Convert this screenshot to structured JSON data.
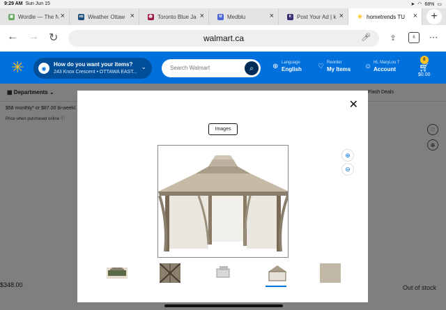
{
  "status": {
    "time": "9:29 AM",
    "date": "Sun Jun 15",
    "battery": "68%"
  },
  "tabs": [
    {
      "label": "Wordle — The N",
      "color": "#6aaa64",
      "glyph": "▦"
    },
    {
      "label": "Weather Ottaw",
      "color": "#1f4e79",
      "glyph": "nb"
    },
    {
      "label": "Toronto Blue Ja",
      "color": "#a0194a",
      "glyph": "⚾"
    },
    {
      "label": "Medblu",
      "color": "#4a66d6",
      "glyph": "M"
    },
    {
      "label": "Post Your Ad | k",
      "color": "#373373",
      "glyph": "K"
    },
    {
      "label": "hometrends TU",
      "color": "#ffc220",
      "glyph": "✳"
    }
  ],
  "url": "walmart.ca",
  "tab_count": "6",
  "header": {
    "store_title": "How do you want your items?",
    "store_address": "243 Knox Crescent • OTTAWA EAST...",
    "search_placeholder": "Search Walmart",
    "language_small": "Language",
    "language_big": "English",
    "reorder_small": "Reorder",
    "reorder_big": "My Items",
    "account_small": "Hi, MaryLou T",
    "account_big": "Account",
    "cart_count": "0",
    "cart_total": "$0.00"
  },
  "page": {
    "departments": "Departments",
    "flash_deals": "Flash Deals",
    "monthly": "$58 monthly* or $87.00 bi-weekl",
    "price_note": "Price when purchased online",
    "price": "$348.00",
    "out_of_stock": "Out of stock"
  },
  "modal": {
    "tab_label": "Images"
  }
}
